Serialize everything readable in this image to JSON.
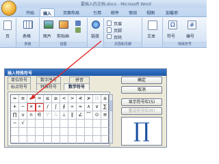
{
  "window": {
    "title": "要插入的文档.docx - Microsoft Word"
  },
  "tabs": [
    "开始",
    "插入",
    "页面布局",
    "引用",
    "邮件",
    "审阅",
    "视图",
    "加载项"
  ],
  "ribbon": {
    "page_btn": "页",
    "table_btn": "表格",
    "picture_btn": "图片",
    "clipart_btn": "剪贴画",
    "link_btn": "链接",
    "header_btn": "页眉",
    "footer_btn": "页脚",
    "pagenum_btn": "页码",
    "textbox_btn": "文本",
    "symbol_btn": "符号",
    "number_btn": "编号",
    "groups": {
      "tables": "表格",
      "illustrations": "插图",
      "header_footer": "页眉和页脚",
      "special": "特殊符号"
    }
  },
  "dialog": {
    "title": "插入特殊符号",
    "tabs": [
      "单位符号",
      "数字序号",
      "拼音",
      "标点符号",
      "特殊符号",
      "数学符号"
    ],
    "ok": "确定",
    "cancel": "取消",
    "show_bar": "显示符号栏(S)",
    "reset_bar": "重设符号栏(R)",
    "preview_symbol": "∏",
    "symbols": [
      [
        "≈",
        "≡",
        "≠",
        "=",
        "≤",
        "≥",
        "<",
        ">",
        "≮",
        "≯",
        "∷",
        "±"
      ],
      [
        "+",
        "−",
        "×",
        "÷",
        "/",
        "∫",
        "∮",
        "∝",
        "∞",
        "∧",
        "∨",
        "∑"
      ],
      [
        "∏",
        "∪",
        "∩",
        "∈",
        "∵",
        "∴",
        "⊥",
        "∥",
        "∠",
        "⌒",
        "⊙",
        "≌"
      ],
      [
        "∽",
        "√",
        "",
        "",
        "",
        "",
        "",
        "",
        "",
        "",
        "",
        ""
      ],
      [
        "",
        "",
        "",
        "",
        "",
        "",
        "",
        "",
        "",
        "",
        "",
        ""
      ],
      [
        "",
        "",
        "",
        "",
        "",
        "",
        "",
        "",
        "",
        "",
        "",
        ""
      ]
    ]
  }
}
